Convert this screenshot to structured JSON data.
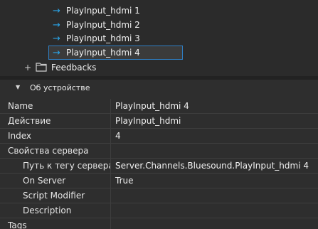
{
  "tree": {
    "items": [
      {
        "label": "PlayInput_hdmi 1",
        "icon": "arrow-right-icon"
      },
      {
        "label": "PlayInput_hdmi 2",
        "icon": "arrow-right-icon"
      },
      {
        "label": "PlayInput_hdmi 3",
        "icon": "arrow-right-icon"
      },
      {
        "label": "PlayInput_hdmi 4",
        "icon": "arrow-right-icon",
        "selected": true
      }
    ],
    "folder": {
      "label": "Feedbacks",
      "expander": "+",
      "icon": "folder-icon"
    }
  },
  "properties": {
    "section_title": "Об устройстве",
    "rows": [
      {
        "name": "Name",
        "value": "PlayInput_hdmi 4"
      },
      {
        "name": "Действие",
        "value": "PlayInput_hdmi"
      },
      {
        "name": "Index",
        "value": "4"
      },
      {
        "name": "Свойства сервера",
        "value": ""
      },
      {
        "name": "Путь к тегу сервера",
        "value": "Server.Channels.Bluesound.PlayInput_hdmi 4"
      },
      {
        "name": "On Server",
        "value": "True"
      },
      {
        "name": "Script Modifier",
        "value": ""
      },
      {
        "name": "Description",
        "value": ""
      },
      {
        "name": "Tags",
        "value": ""
      }
    ]
  },
  "colors": {
    "background": "#2b2b2b",
    "accent": "#2aa3e6",
    "selection_border": "#2f7fc4"
  }
}
